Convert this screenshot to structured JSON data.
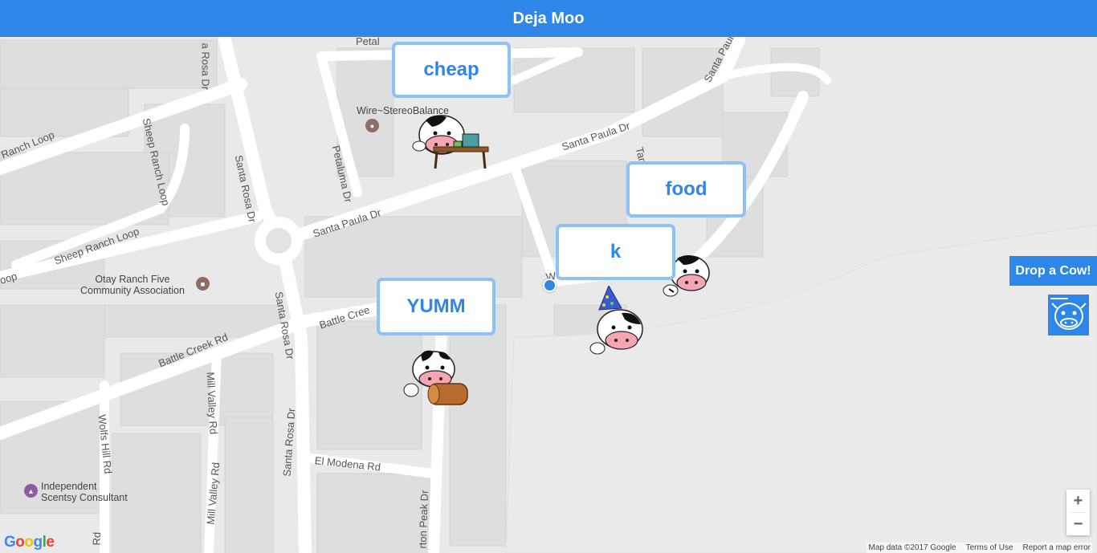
{
  "app": {
    "title": "Deja Moo"
  },
  "bubbles": [
    {
      "text": "cheap"
    },
    {
      "text": "food"
    },
    {
      "text": "k"
    },
    {
      "text": "YUMM"
    }
  ],
  "controls": {
    "drop_label": "Drop a Cow!",
    "zoom_in": "+",
    "zoom_out": "−"
  },
  "road_labels": {
    "santa_rosa_dr": "Santa Rosa Dr",
    "santa_rosa_dr_top": "a Rosa Dr",
    "petaluma_dr": "Petaluma Dr",
    "petal_top": "Petal",
    "santa_paula_dr": "Santa Paula Dr",
    "santa_paula_top": "Santa Paula",
    "sheep_ranch_loop": "Sheep Ranch Loop",
    "ranch_loop": "Ranch Loop",
    "oop": "oop",
    "battle_creek_rd": "Battle Creek Rd",
    "battle_cree": "Battle Cree",
    "mill_valley_rd": "Mill Valley Rd",
    "wolfs_hill_rd": "Wolfs Hill Rd",
    "el_modena_rd": "El Modena Rd",
    "rd_bottom": "Rd",
    "wheatville": "Wheatville St",
    "taru": "Taru",
    "rton_peak": "rton Peak Dr"
  },
  "pois": {
    "wire": "Wire~StereoBalance",
    "otay_line1": "Otay Ranch Five",
    "otay_line2": "Community Association",
    "scentsy_line1": "Independent",
    "scentsy_line2": "Scentsy Consultant"
  },
  "attribution": {
    "map_data": "Map data ©2017 Google",
    "terms": "Terms of Use",
    "report": "Report a map error"
  },
  "google_logo": "Google",
  "colors": {
    "header": "#2e86e8",
    "bubble_border": "#8ec1f7",
    "bubble_text": "#2e86e8"
  }
}
